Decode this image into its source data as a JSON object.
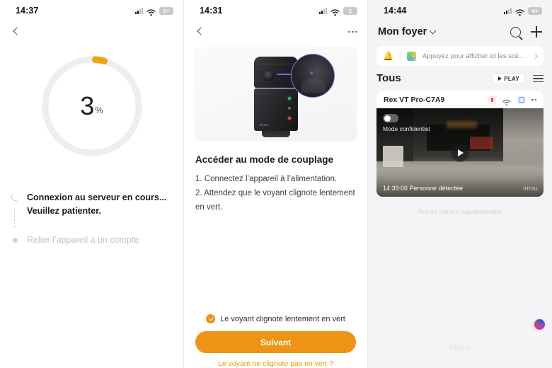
{
  "panel1": {
    "status": {
      "time": "14:37",
      "battery": "2+",
      "signal_icon": "signal-bars-icon",
      "wifi_icon": "wifi-icon"
    },
    "nav": {
      "back_icon": "back-chevron-icon"
    },
    "progress": {
      "value": "3",
      "unit": "%",
      "percent": 3,
      "track_color": "#eeeeee",
      "arc_color": "#f0a318"
    },
    "steps": [
      {
        "label": "Connexion au serveur en cours...",
        "label2": "Veuillez patienter.",
        "state": "active",
        "icon": "spinner-icon"
      },
      {
        "label": "Relier l’appareil à un compte",
        "state": "pending",
        "icon": "dot-icon"
      }
    ]
  },
  "panel2": {
    "status": {
      "time": "14:31",
      "battery": "2",
      "signal_icon": "signal-bars-icon",
      "wifi_icon": "wifi-icon"
    },
    "nav": {
      "back_icon": "back-chevron-icon",
      "more_icon": "more-horizontal-icon"
    },
    "hero": {
      "device_brand": "imou",
      "image_name": "camera-pairing-illustration"
    },
    "title": "Accéder au mode de couplage",
    "instructions": [
      "1. Connectez l’appareil à l’alimentation.",
      "2. Attendez que le voyant clignote lentement en vert."
    ],
    "checkbox": {
      "label": "Le voyant clignote lentement en vert",
      "checked": true
    },
    "next_button": "Suivant",
    "help_link": "Le voyant ne clignote pas en vert ?",
    "accent_color": "#ef9314"
  },
  "panel3": {
    "status": {
      "time": "14:44",
      "battery": "4+",
      "signal_icon": "signal-bars-icon",
      "wifi_icon": "wifi-icon"
    },
    "header": {
      "home_name": "Mon foyer",
      "chevron_icon": "chevron-down-icon",
      "search_icon": "search-icon",
      "add_icon": "plus-icon"
    },
    "banner": {
      "bell_icon": "bell-icon",
      "scene_icon": "scenes-icon",
      "text": "Appuyez pour afficher ici les scènes...",
      "chevron_icon": "chevron-right-icon"
    },
    "tabs": {
      "active": "Tous",
      "play_label": "PLAY",
      "play_icon": "play-triangle-icon",
      "list_icon": "list-view-icon"
    },
    "device": {
      "name": "Rex VT Pro-C7A9",
      "icons": [
        "battery-icon",
        "wifi-icon",
        "cloud-storage-icon",
        "more-horizontal-icon"
      ],
      "privacy_toggle_label": "Mode confidentiel",
      "privacy_toggle_on": false,
      "play_icon": "play-button-icon",
      "event_caption": "14:39:06 Personne détectée",
      "watermark": "imou"
    },
    "no_more_text": "Pas de caméra supplémentaire",
    "footer": {
      "watermark": "imou",
      "assistant_icon": "assistant-orb-icon"
    }
  }
}
